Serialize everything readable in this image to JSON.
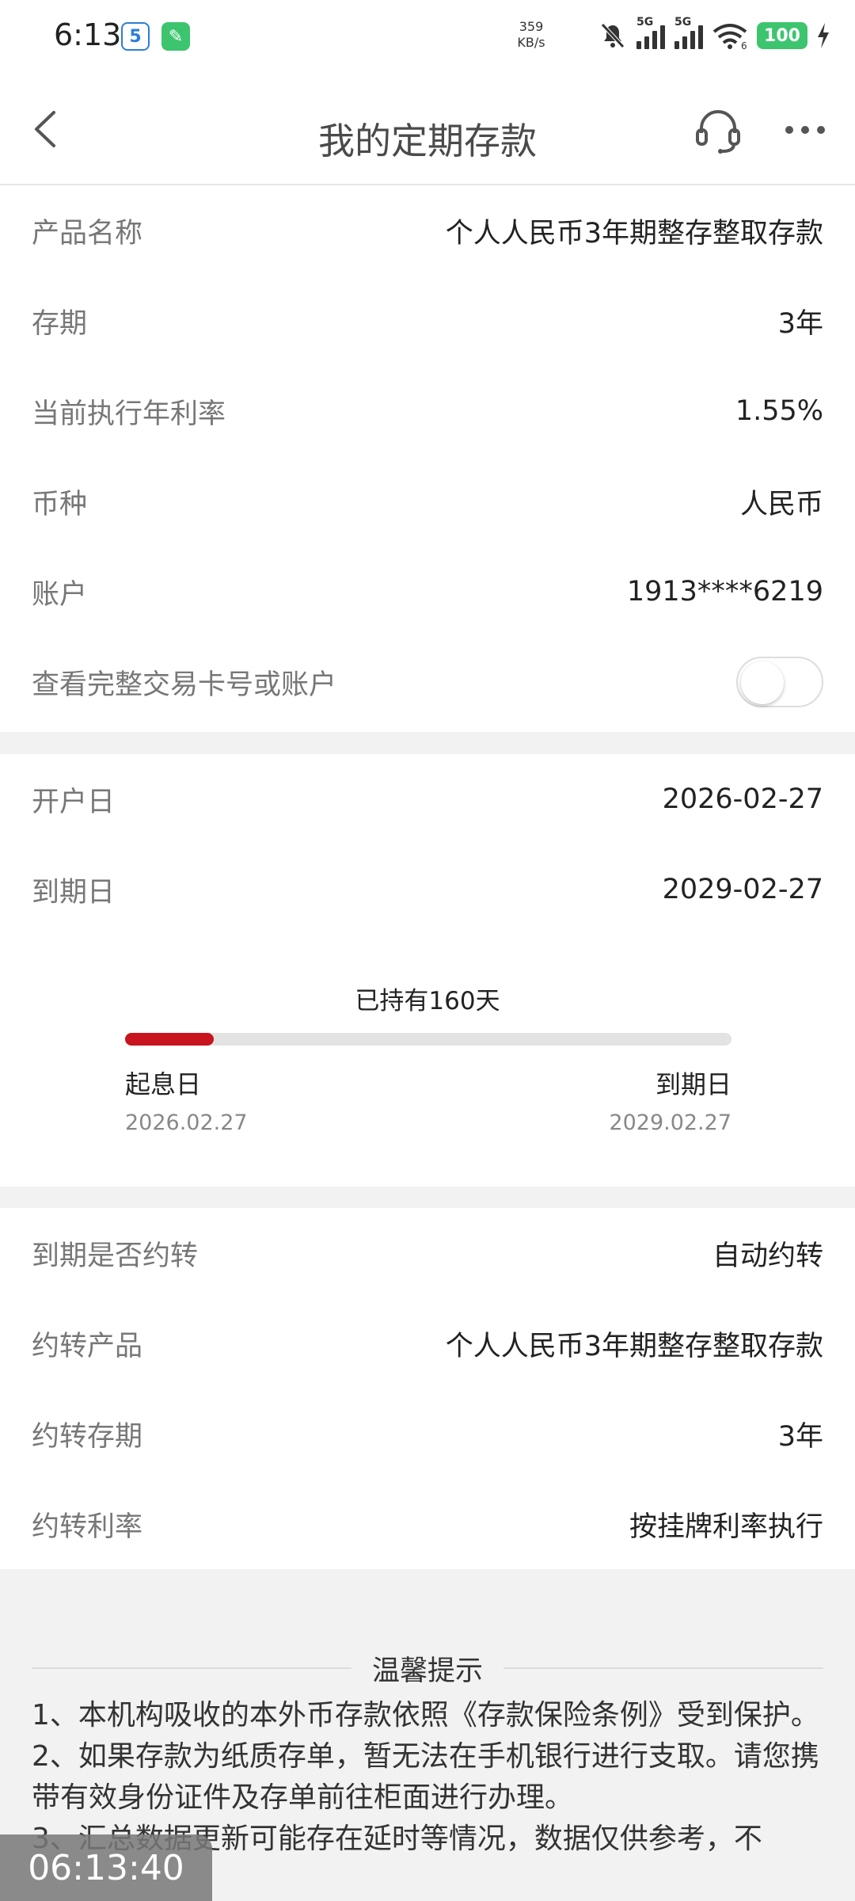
{
  "status_bar": {
    "time": "6:13",
    "net_speed_value": "359",
    "net_speed_unit": "KB/s",
    "signal1_label": "5G",
    "signal2_label": "5G",
    "wifi_label": "6",
    "battery": "100"
  },
  "header": {
    "title": "我的定期存款"
  },
  "section1": {
    "rows": [
      {
        "label": "产品名称",
        "value": "个人人民币3年期整存整取存款"
      },
      {
        "label": "存期",
        "value": "3年"
      },
      {
        "label": "当前执行年利率",
        "value": "1.55%"
      },
      {
        "label": "币种",
        "value": "人民币"
      },
      {
        "label": "账户",
        "value": "1913****6219"
      }
    ],
    "toggle_label": "查看完整交易卡号或账户",
    "toggle_on": false
  },
  "section2": {
    "rows": [
      {
        "label": "开户日",
        "value": "2026-02-27"
      },
      {
        "label": "到期日",
        "value": "2029-02-27"
      }
    ],
    "progress": {
      "held_text": "已持有160天",
      "fraction": 0.146,
      "start_label": "起息日",
      "start_date": "2026.02.27",
      "end_label": "到期日",
      "end_date": "2029.02.27"
    }
  },
  "section3": {
    "rows": [
      {
        "label": "到期是否约转",
        "value": "自动约转"
      },
      {
        "label": "约转产品",
        "value": "个人人民币3年期整存整取存款"
      },
      {
        "label": "约转存期",
        "value": "3年"
      },
      {
        "label": "约转利率",
        "value": "按挂牌利率执行"
      }
    ]
  },
  "tips": {
    "title": "温馨提示",
    "items": [
      "1、本机构吸收的本外币存款依照《存款保险条例》受到保护。",
      "2、如果存款为纸质存单，暂无法在手机银行进行支取。请您携带有效身份证件及存单前往柜面进行办理。",
      "3、汇总数据更新可能存在延时等情况，数据仅供参考，不"
    ]
  },
  "recording_timer": "06:13:40"
}
